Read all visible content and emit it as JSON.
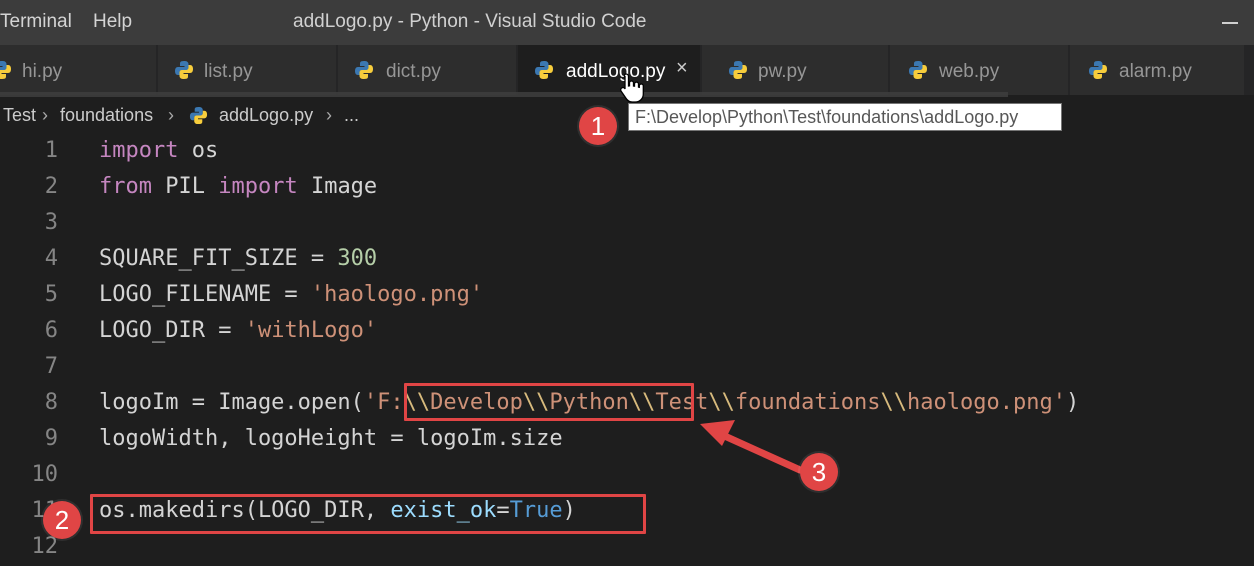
{
  "titlebar": {
    "menu": [
      "Terminal",
      "Help"
    ],
    "window_title": "addLogo.py - Python - Visual Studio Code"
  },
  "tabs": [
    {
      "label": "hi.py",
      "active": false
    },
    {
      "label": "list.py",
      "active": false
    },
    {
      "label": "dict.py",
      "active": false
    },
    {
      "label": "addLogo.py",
      "active": true,
      "close_glyph": "×"
    },
    {
      "label": "pw.py",
      "active": false
    },
    {
      "label": "web.py",
      "active": false
    },
    {
      "label": "alarm.py",
      "active": false
    }
  ],
  "breadcrumb": {
    "items": [
      "Test",
      "foundations",
      "addLogo.py",
      "..."
    ],
    "separator": "›"
  },
  "tooltip": {
    "text": "F:\\Develop\\Python\\Test\\foundations\\addLogo.py"
  },
  "editor": {
    "line_numbers": [
      "1",
      "2",
      "3",
      "4",
      "5",
      "6",
      "7",
      "8",
      "9",
      "10",
      "11",
      "12"
    ],
    "lines": {
      "l1": {
        "kw": "import",
        "rest": " os"
      },
      "l2": {
        "kw1": "from",
        "mid": " PIL ",
        "kw2": "import",
        "rest": " Image"
      },
      "l4": {
        "name": "SQUARE_FIT_SIZE = ",
        "num": "300"
      },
      "l5": {
        "name": "LOGO_FILENAME = ",
        "str": "'haologo.png'"
      },
      "l6": {
        "name": "LOGO_DIR = ",
        "str": "'withLogo'"
      },
      "l8": {
        "pre": "logoIm = Image.open(",
        "q": "'",
        "s1": "F:",
        "e1": "\\\\",
        "s2": "Develop",
        "e2": "\\\\",
        "s3": "Python",
        "e3": "\\\\",
        "s4": "Test",
        "e4": "\\\\",
        "s5": "foundations",
        "e5": "\\\\",
        "s6": "haologo.png'",
        "post": ")"
      },
      "l9": {
        "text": "logoWidth, logoHeight = logoIm.size"
      },
      "l11": {
        "pre": "os.makedirs(LOGO_DIR, ",
        "param": "exist_ok",
        "eq": "=",
        "const": "True",
        "post": ")"
      }
    }
  },
  "annotations": {
    "badges": [
      "1",
      "2",
      "3"
    ],
    "color": "#e04545"
  },
  "colors": {
    "keyword": "#c586c0",
    "string": "#ce9178",
    "number": "#b5cea8",
    "parameter": "#9cdcfe",
    "constant": "#569cd6"
  }
}
